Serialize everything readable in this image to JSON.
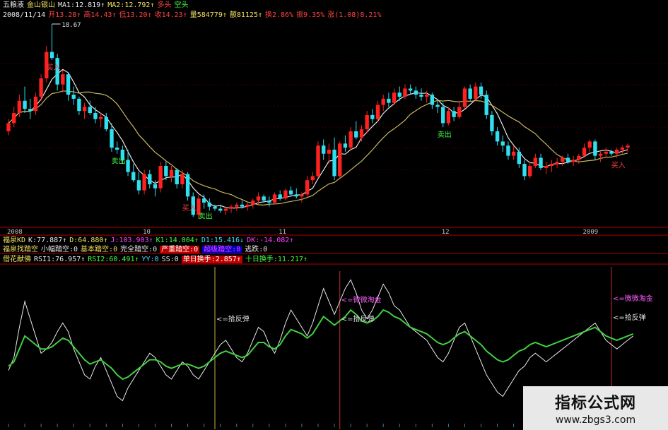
{
  "header": {
    "title_items": [
      {
        "text": "五粮液",
        "cls": "wht"
      },
      {
        "text": "金山银山",
        "cls": "yel"
      },
      {
        "text": "MA1:12.819↑",
        "cls": "wht"
      },
      {
        "text": "MA2:12.792↑",
        "cls": "yel"
      },
      {
        "text": "多头",
        "cls": "red"
      },
      {
        "text": "空头",
        "cls": "grn"
      }
    ],
    "ohlc_items": [
      {
        "text": "2008/11/14",
        "cls": "wht"
      },
      {
        "text": "开13.28↑",
        "cls": "red"
      },
      {
        "text": "高14.43↑",
        "cls": "red"
      },
      {
        "text": "低13.20↑",
        "cls": "red"
      },
      {
        "text": "收14.23↑",
        "cls": "red"
      },
      {
        "text": "量584779↑",
        "cls": "yel"
      },
      {
        "text": "额81125↑",
        "cls": "yel"
      },
      {
        "text": "换2.86%",
        "cls": "red"
      },
      {
        "text": "振9.35%",
        "cls": "red"
      },
      {
        "text": "涨(1.08)8.21%",
        "cls": "red"
      }
    ]
  },
  "panels": {
    "kdj_items": [
      {
        "text": "福泉KD",
        "cls": "yel"
      },
      {
        "text": "K:77.887↑",
        "cls": "wht"
      },
      {
        "text": "D:64.880↑",
        "cls": "yel"
      },
      {
        "text": "J:103.903↑",
        "cls": "mag"
      },
      {
        "text": "K1:14.004↑",
        "cls": "grn"
      },
      {
        "text": "D1:15.416↓",
        "cls": "cyn"
      },
      {
        "text": "DK:-14.082↑",
        "cls": "mag"
      }
    ],
    "pattern_items": [
      {
        "text": "福泉找踏空",
        "cls": "yel"
      },
      {
        "text": "小幅踏空:0",
        "cls": "wht"
      },
      {
        "text": "基本踏空:0",
        "cls": "yel"
      },
      {
        "text": "完全踏空:0",
        "cls": "wht"
      },
      {
        "text": "严重踏空:0",
        "cls": "hl-red"
      },
      {
        "text": "超级踏空:0",
        "cls": "hl-blu"
      },
      {
        "text": "逃跌:0",
        "cls": "wht"
      }
    ],
    "rsi_items": [
      {
        "text": "借花献佛",
        "cls": "yel"
      },
      {
        "text": "RSI1:76.957↑",
        "cls": "wht"
      },
      {
        "text": "RSI2:60.491↑",
        "cls": "grn"
      },
      {
        "text": "YY:0",
        "cls": "cyn"
      },
      {
        "text": "SS:0",
        "cls": "wht"
      },
      {
        "text": "单日换手:2.857↑",
        "cls": "hl-red"
      },
      {
        "text": "十日换手:11.217↑",
        "cls": "grn"
      }
    ]
  },
  "colors": {
    "up": "#ff2020",
    "down": "#30e0f0",
    "ma1": "#e8e8e8",
    "ma2": "#c8b860",
    "grid_red": "#b00000",
    "rsi_fast": "#e8e8e8",
    "rsi_slow": "#40d040"
  },
  "chart_data": [
    {
      "type": "candlestick",
      "title": "五粮液",
      "price_labels": {
        "high_marker": "18.67"
      },
      "x_axis_labels": [
        "2008",
        "10",
        "11",
        "12",
        "2009"
      ],
      "annotations": [
        {
          "text": "买入",
          "color": "#ff4040",
          "index": 8
        },
        {
          "text": "卖出",
          "color": "#40ff40",
          "index": 20
        },
        {
          "text": "买入",
          "color": "#ff4040",
          "index": 33
        },
        {
          "text": "卖出",
          "color": "#40ff40",
          "index": 36
        },
        {
          "text": "卖出",
          "color": "#40ff40",
          "index": 80
        },
        {
          "text": "买入",
          "color": "#ff4040",
          "index": 112
        }
      ],
      "candles": [
        [
          13.4,
          14.0,
          13.2,
          13.8
        ],
        [
          13.8,
          14.6,
          13.6,
          14.3
        ],
        [
          14.3,
          15.2,
          14.1,
          14.9
        ],
        [
          14.9,
          15.6,
          14.3,
          14.5
        ],
        [
          14.5,
          15.0,
          14.0,
          14.4
        ],
        [
          14.4,
          15.3,
          14.2,
          15.1
        ],
        [
          15.1,
          16.2,
          14.9,
          16.0
        ],
        [
          16.0,
          17.6,
          15.8,
          17.3
        ],
        [
          17.3,
          18.67,
          16.9,
          17.0
        ],
        [
          17.0,
          17.2,
          15.4,
          15.7
        ],
        [
          15.7,
          16.4,
          15.3,
          16.2
        ],
        [
          16.2,
          16.3,
          14.9,
          15.2
        ],
        [
          15.2,
          15.6,
          14.7,
          15.0
        ],
        [
          15.0,
          15.1,
          14.2,
          14.4
        ],
        [
          14.4,
          14.8,
          14.0,
          14.6
        ],
        [
          14.6,
          14.9,
          14.2,
          14.3
        ],
        [
          14.3,
          14.6,
          13.8,
          14.0
        ],
        [
          14.0,
          14.3,
          13.6,
          14.1
        ],
        [
          14.1,
          14.3,
          13.4,
          13.5
        ],
        [
          13.5,
          13.8,
          12.4,
          12.6
        ],
        [
          12.6,
          12.9,
          12.3,
          12.5
        ],
        [
          12.5,
          12.7,
          11.8,
          12.0
        ],
        [
          12.0,
          12.5,
          11.2,
          11.4
        ],
        [
          11.4,
          11.8,
          10.9,
          11.0
        ],
        [
          11.0,
          11.4,
          10.3,
          10.5
        ],
        [
          10.5,
          11.5,
          10.3,
          11.3
        ],
        [
          11.3,
          11.5,
          10.6,
          10.8
        ],
        [
          10.8,
          11.0,
          10.2,
          10.6
        ],
        [
          10.6,
          11.9,
          10.4,
          11.7
        ],
        [
          11.7,
          11.9,
          11.0,
          11.2
        ],
        [
          11.2,
          11.7,
          10.9,
          11.5
        ],
        [
          11.5,
          11.6,
          10.6,
          10.8
        ],
        [
          10.8,
          11.5,
          10.6,
          11.3
        ],
        [
          11.3,
          11.4,
          10.0,
          10.2
        ],
        [
          10.2,
          10.4,
          9.2,
          9.3
        ],
        [
          9.3,
          10.3,
          9.1,
          10.1
        ],
        [
          10.1,
          10.3,
          9.6,
          9.9
        ],
        [
          9.9,
          10.1,
          9.5,
          9.7
        ],
        [
          9.7,
          9.8,
          9.5,
          9.6
        ],
        [
          9.6,
          9.8,
          9.4,
          9.5
        ],
        [
          9.5,
          9.7,
          9.3,
          9.6
        ],
        [
          9.6,
          9.8,
          9.4,
          9.7
        ],
        [
          9.7,
          9.9,
          9.5,
          9.8
        ],
        [
          9.8,
          10.0,
          9.6,
          9.7
        ],
        [
          9.7,
          9.9,
          9.5,
          9.8
        ],
        [
          9.8,
          10.1,
          9.6,
          10.0
        ],
        [
          10.0,
          10.4,
          9.8,
          10.2
        ],
        [
          10.2,
          10.3,
          9.9,
          10.0
        ],
        [
          10.0,
          10.2,
          9.7,
          9.9
        ],
        [
          9.9,
          10.4,
          9.8,
          10.3
        ],
        [
          10.3,
          10.5,
          10.0,
          10.1
        ],
        [
          10.1,
          10.6,
          10.0,
          10.5
        ],
        [
          10.5,
          10.7,
          10.2,
          10.3
        ],
        [
          10.3,
          10.6,
          10.1,
          10.2
        ],
        [
          10.2,
          10.4,
          9.9,
          10.3
        ],
        [
          10.3,
          11.2,
          10.2,
          11.0
        ],
        [
          11.0,
          11.4,
          10.8,
          11.2
        ],
        [
          11.2,
          12.9,
          11.1,
          12.7
        ],
        [
          12.7,
          13.0,
          12.0,
          12.3
        ],
        [
          12.3,
          12.8,
          11.8,
          12.5
        ],
        [
          12.5,
          13.1,
          11.0,
          11.2
        ],
        [
          11.2,
          12.9,
          11.1,
          12.8
        ],
        [
          12.8,
          13.2,
          12.4,
          12.6
        ],
        [
          12.6,
          13.6,
          12.5,
          13.4
        ],
        [
          13.4,
          13.9,
          13.0,
          13.1
        ],
        [
          13.1,
          13.7,
          12.9,
          13.5
        ],
        [
          13.5,
          14.4,
          13.3,
          14.2
        ],
        [
          14.2,
          14.5,
          13.8,
          14.0
        ],
        [
          14.0,
          14.9,
          13.9,
          14.7
        ],
        [
          14.7,
          15.2,
          14.4,
          15.0
        ],
        [
          15.0,
          15.3,
          14.6,
          14.8
        ],
        [
          14.8,
          15.5,
          14.7,
          15.3
        ],
        [
          15.3,
          15.6,
          14.9,
          15.1
        ],
        [
          15.1,
          15.7,
          15.0,
          15.5
        ],
        [
          15.5,
          15.7,
          15.2,
          15.4
        ],
        [
          15.4,
          15.6,
          15.0,
          15.2
        ],
        [
          15.2,
          15.5,
          14.9,
          15.1
        ],
        [
          15.1,
          15.4,
          14.8,
          15.2
        ],
        [
          15.2,
          15.3,
          14.5,
          14.7
        ],
        [
          14.7,
          14.9,
          14.3,
          14.6
        ],
        [
          14.6,
          14.8,
          13.6,
          13.8
        ],
        [
          13.8,
          14.6,
          13.7,
          14.4
        ],
        [
          14.4,
          14.6,
          13.9,
          14.1
        ],
        [
          14.1,
          14.9,
          14.0,
          14.6
        ],
        [
          14.6,
          15.6,
          14.5,
          15.5
        ],
        [
          15.5,
          15.7,
          14.9,
          15.0
        ],
        [
          15.0,
          15.8,
          14.9,
          15.6
        ],
        [
          15.6,
          15.8,
          15.0,
          15.2
        ],
        [
          15.2,
          15.4,
          14.0,
          14.2
        ],
        [
          14.2,
          14.4,
          13.2,
          13.4
        ],
        [
          13.4,
          13.6,
          12.7,
          12.9
        ],
        [
          12.9,
          13.2,
          12.4,
          12.7
        ],
        [
          12.7,
          12.9,
          12.0,
          12.2
        ],
        [
          12.2,
          12.7,
          12.0,
          12.4
        ],
        [
          12.4,
          12.6,
          11.6,
          11.8
        ],
        [
          11.8,
          12.0,
          11.0,
          11.2
        ],
        [
          11.2,
          11.9,
          11.1,
          11.7
        ],
        [
          11.7,
          12.3,
          11.6,
          12.1
        ],
        [
          12.1,
          12.3,
          11.5,
          11.6
        ],
        [
          11.6,
          11.9,
          11.3,
          11.7
        ],
        [
          11.7,
          12.0,
          11.4,
          11.8
        ],
        [
          11.8,
          12.1,
          11.6,
          11.9
        ],
        [
          11.9,
          12.2,
          11.7,
          12.1
        ],
        [
          12.1,
          12.3,
          11.8,
          11.9
        ],
        [
          11.9,
          12.2,
          11.7,
          12.0
        ],
        [
          12.0,
          12.3,
          11.8,
          12.2
        ],
        [
          12.2,
          12.8,
          12.1,
          12.6
        ],
        [
          12.6,
          13.0,
          12.4,
          12.9
        ],
        [
          12.9,
          13.0,
          12.0,
          12.2
        ],
        [
          12.2,
          12.4,
          11.9,
          12.3
        ],
        [
          12.3,
          12.6,
          12.1,
          12.4
        ],
        [
          12.4,
          12.5,
          12.2,
          12.3
        ],
        [
          12.3,
          12.6,
          12.1,
          12.5
        ],
        [
          12.5,
          12.7,
          12.3,
          12.6
        ],
        [
          12.6,
          12.8,
          12.4,
          12.7
        ]
      ]
    },
    {
      "type": "line",
      "title": "借花献佛",
      "series": [
        {
          "name": "RSI1",
          "values": [
            42,
            48,
            62,
            74,
            66,
            58,
            50,
            52,
            55,
            60,
            64,
            60,
            52,
            46,
            40,
            38,
            44,
            48,
            42,
            36,
            30,
            28,
            34,
            38,
            42,
            46,
            50,
            48,
            44,
            40,
            38,
            42,
            46,
            44,
            40,
            38,
            42,
            46,
            50,
            54,
            56,
            52,
            48,
            46,
            50,
            56,
            62,
            60,
            54,
            50,
            56,
            64,
            70,
            66,
            62,
            58,
            64,
            72,
            80,
            74,
            68,
            74,
            80,
            84,
            78,
            70,
            66,
            70,
            76,
            82,
            78,
            72,
            70,
            66,
            62,
            60,
            58,
            56,
            52,
            48,
            46,
            50,
            56,
            62,
            64,
            58,
            52,
            46,
            40,
            36,
            32,
            30,
            34,
            38,
            42,
            44,
            48,
            50,
            48,
            46,
            48,
            50,
            52,
            54,
            56,
            58,
            60,
            62,
            64,
            60,
            56,
            54,
            52,
            54,
            56,
            58
          ]
        },
        {
          "name": "RSI2",
          "values": [
            44,
            46,
            52,
            58,
            56,
            54,
            52,
            52,
            53,
            55,
            57,
            56,
            53,
            50,
            47,
            45,
            46,
            47,
            45,
            43,
            40,
            38,
            39,
            41,
            43,
            45,
            47,
            47,
            46,
            44,
            43,
            44,
            45,
            45,
            44,
            43,
            44,
            46,
            48,
            50,
            51,
            50,
            49,
            48,
            49,
            52,
            55,
            55,
            53,
            52,
            54,
            58,
            61,
            60,
            59,
            57,
            59,
            63,
            67,
            65,
            63,
            65,
            67,
            70,
            68,
            65,
            64,
            65,
            67,
            70,
            69,
            67,
            66,
            64,
            62,
            61,
            60,
            59,
            57,
            55,
            54,
            55,
            57,
            59,
            60,
            58,
            56,
            54,
            51,
            49,
            47,
            46,
            47,
            49,
            51,
            52,
            54,
            55,
            54,
            53,
            54,
            55,
            56,
            57,
            58,
            59,
            60,
            61,
            62,
            60,
            58,
            57,
            56,
            57,
            58,
            59
          ]
        }
      ],
      "annotations": [
        {
          "text": "<=拾反弹",
          "index": 38
        },
        {
          "text": "<=微微淘金",
          "index": 61
        },
        {
          "text": "<=拾反弹",
          "index": 61
        },
        {
          "text": "<=微微淘金",
          "index": 111
        },
        {
          "text": "<=拾反弹",
          "index": 111
        }
      ]
    }
  ],
  "watermark": {
    "title": "指标公式网",
    "url": "www.zbgs3.com"
  }
}
